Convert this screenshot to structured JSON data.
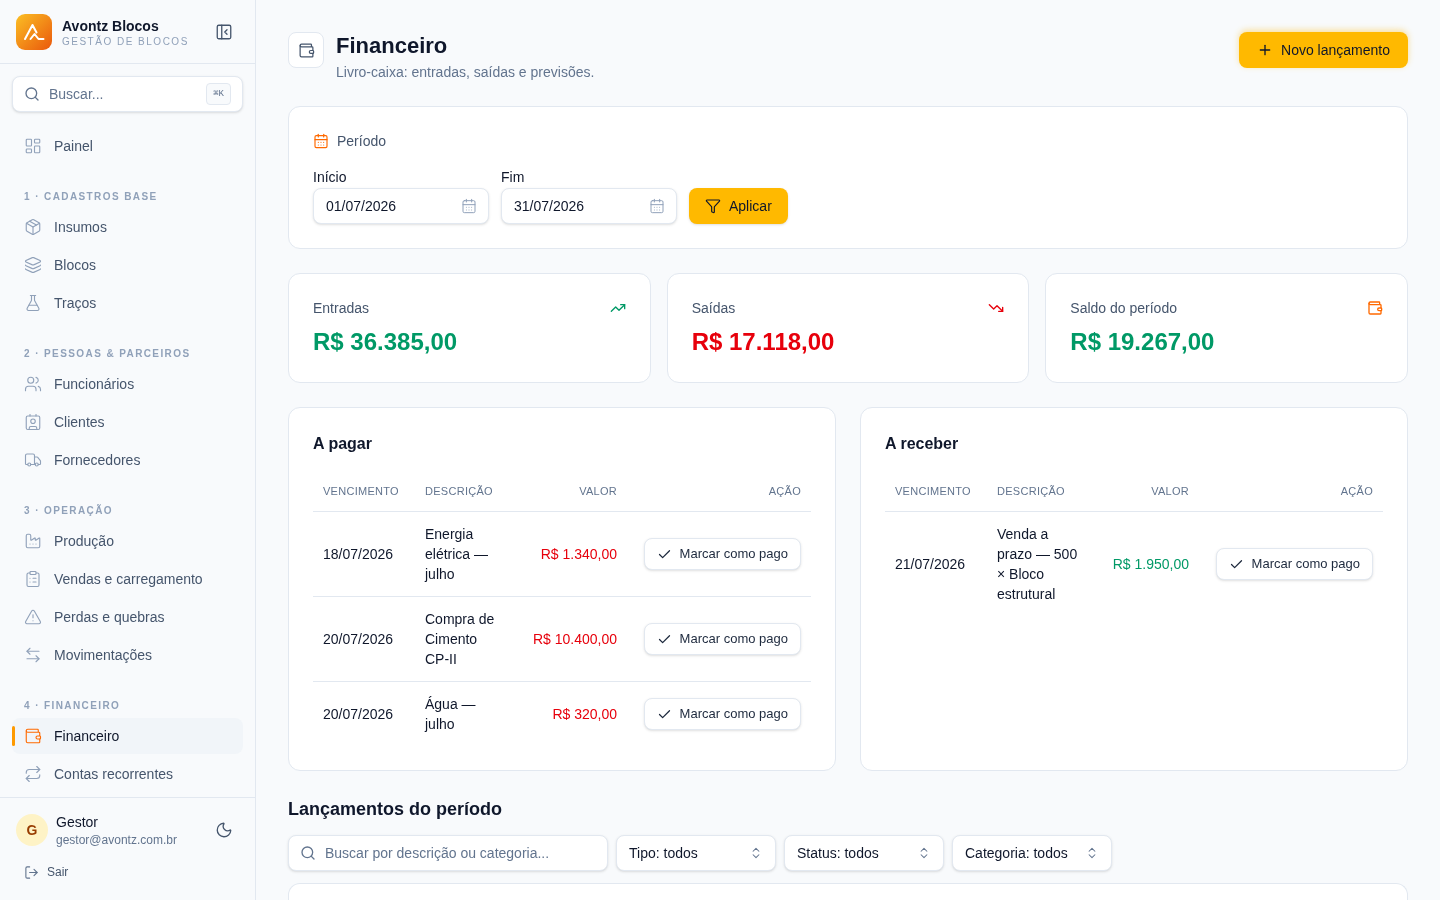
{
  "sidebar": {
    "brand": {
      "name": "Avontz Blocos",
      "tagline": "GESTÃO DE BLOCOS"
    },
    "search": {
      "placeholder": "Buscar...",
      "shortcut": "⌘K"
    },
    "sections": [
      {
        "items": [
          {
            "label": "Painel",
            "selected": false
          }
        ]
      },
      {
        "heading": "1 · CADASTROS BASE",
        "items": [
          {
            "label": "Insumos",
            "selected": false
          },
          {
            "label": "Blocos",
            "selected": false
          },
          {
            "label": "Traços",
            "selected": false
          }
        ]
      },
      {
        "heading": "2 · PESSOAS & PARCEIROS",
        "items": [
          {
            "label": "Funcionários",
            "selected": false
          },
          {
            "label": "Clientes",
            "selected": false
          },
          {
            "label": "Fornecedores",
            "selected": false
          }
        ]
      },
      {
        "heading": "3 · OPERAÇÃO",
        "items": [
          {
            "label": "Produção",
            "selected": false
          },
          {
            "label": "Vendas e carregamento",
            "selected": false
          },
          {
            "label": "Perdas e quebras",
            "selected": false
          },
          {
            "label": "Movimentações",
            "selected": false
          }
        ]
      },
      {
        "heading": "4 · FINANCEIRO",
        "items": [
          {
            "label": "Financeiro",
            "selected": true
          },
          {
            "label": "Contas recorrentes",
            "selected": false
          }
        ]
      }
    ],
    "user": {
      "initial": "G",
      "name": "Gestor",
      "email": "gestor@avontz.com.br"
    },
    "logout": "Sair"
  },
  "header": {
    "title": "Financeiro",
    "subtitle": "Livro-caixa: entradas, saídas e previsões.",
    "new_button": "Novo lançamento"
  },
  "period": {
    "title": "Período",
    "fields": [
      {
        "label": "Início",
        "value": "01/07/2026"
      },
      {
        "label": "Fim",
        "value": "31/07/2026"
      }
    ],
    "apply_button": "Aplicar"
  },
  "stats": [
    {
      "kind": "income",
      "label": "Entradas",
      "value": "R$ 36.385,00"
    },
    {
      "kind": "expense",
      "label": "Saídas",
      "value": "R$ 17.118,00"
    },
    {
      "kind": "balance",
      "label": "Saldo do período",
      "value": "R$ 19.267,00"
    }
  ],
  "ledgers": [
    {
      "kind": "payable",
      "title": "A pagar",
      "columns": [
        "VENCIMENTO",
        "DESCRIÇÃO",
        "VALOR",
        "AÇÃO"
      ],
      "rows": [
        {
          "due": "18/07/2026",
          "description": "Energia elétrica — julho",
          "amount": "R$ 1.340,00",
          "action": "Marcar como pago"
        },
        {
          "due": "20/07/2026",
          "description": "Compra de Cimento CP-II",
          "amount": "R$ 10.400,00",
          "action": "Marcar como pago"
        },
        {
          "due": "20/07/2026",
          "description": "Água — julho",
          "amount": "R$ 320,00",
          "action": "Marcar como pago"
        }
      ]
    },
    {
      "kind": "receivable",
      "title": "A receber",
      "columns": [
        "VENCIMENTO",
        "DESCRIÇÃO",
        "VALOR",
        "AÇÃO"
      ],
      "rows": [
        {
          "due": "21/07/2026",
          "description": "Venda a prazo — 500 × Bloco estrutural",
          "amount": "R$ 1.950,00",
          "action": "Marcar como pago"
        }
      ]
    }
  ],
  "entries": {
    "title": "Lançamentos do período",
    "search": {
      "placeholder": "Buscar por descrição ou categoria..."
    },
    "filters": [
      "Tipo: todos",
      "Status: todos",
      "Categoria: todos"
    ]
  }
}
